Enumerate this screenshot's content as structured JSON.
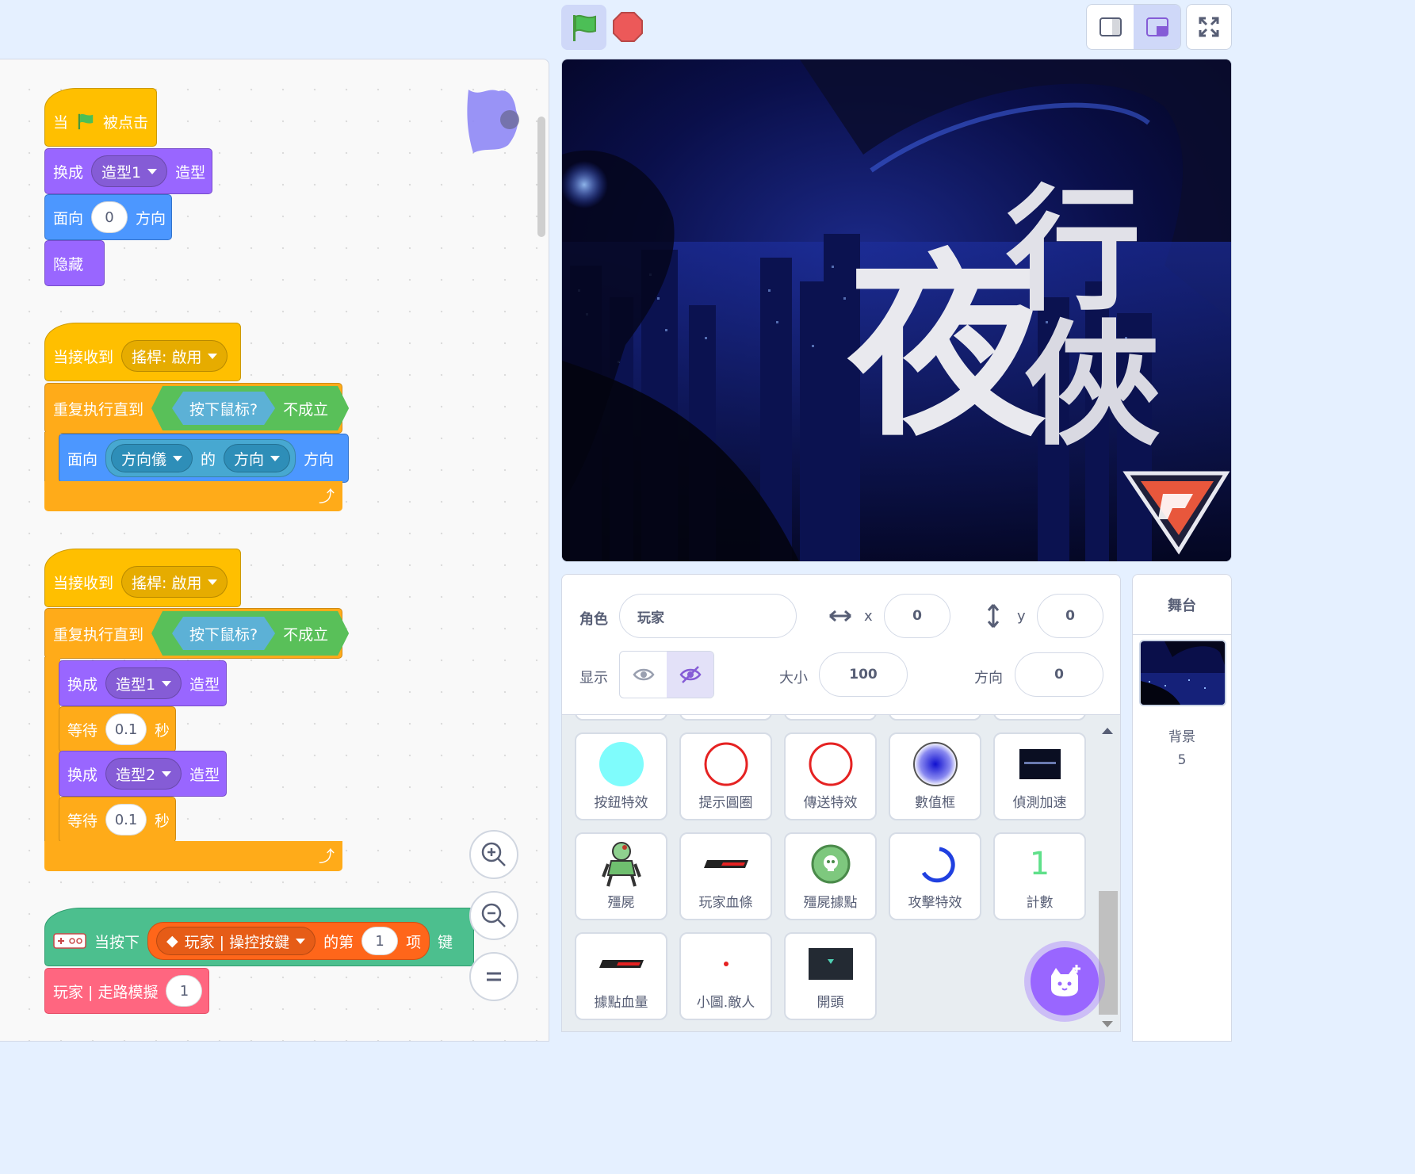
{
  "blocks": {
    "script1": {
      "hat_when": "当",
      "hat_clicked": "被点击",
      "switch_label": "换成",
      "costume1": "造型1",
      "costume_suffix": "造型",
      "point_label": "面向",
      "point_value": "0",
      "direction_suffix": "方向",
      "hide_label": "隐藏"
    },
    "script2": {
      "when_receive": "当接收到",
      "message": "搖桿: 啟用",
      "repeat_until": "重复执行直到",
      "mouse_down": "按下鼠标?",
      "not_true": "不成立",
      "point_label": "面向",
      "joystick": "方向儀",
      "of_label": "的",
      "direction_attr": "方向",
      "direction_suffix": "方向"
    },
    "script3": {
      "when_receive": "当接收到",
      "message": "搖桿: 啟用",
      "repeat_until": "重复执行直到",
      "mouse_down": "按下鼠标?",
      "not_true": "不成立",
      "switch_label": "换成",
      "costume1": "造型1",
      "costume_suffix": "造型",
      "wait_label": "等待",
      "wait_value": "0.1",
      "seconds_suffix": "秒",
      "costume2": "造型2"
    },
    "script4": {
      "when_pressed": "当按下",
      "key_reporter": "玩家 | 操控按鍵",
      "index_prefix": "的第",
      "index_value": "1",
      "item_label": "项",
      "key_suffix": "键",
      "custom_block": "玩家 | 走路模擬",
      "custom_arg": "1"
    }
  },
  "sprite_info": {
    "sprite_label": "角色",
    "sprite_name": "玩家",
    "x_label": "x",
    "x_value": "0",
    "y_label": "y",
    "y_value": "0",
    "show_label": "显示",
    "size_label": "大小",
    "size_value": "100",
    "direction_label": "方向",
    "direction_value": "0"
  },
  "sprites": [
    {
      "name": "按鈕特效",
      "thumb": "cyan-circle"
    },
    {
      "name": "提示圓圈",
      "thumb": "red-ring"
    },
    {
      "name": "傳送特效",
      "thumb": "red-ring"
    },
    {
      "name": "數值框",
      "thumb": "blue-orb"
    },
    {
      "name": "偵測加速",
      "thumb": "dark-rect"
    },
    {
      "name": "殭屍",
      "thumb": "zombie"
    },
    {
      "name": "玩家血條",
      "thumb": "health-bar"
    },
    {
      "name": "殭屍據點",
      "thumb": "green-skull"
    },
    {
      "name": "攻擊特效",
      "thumb": "blue-arc"
    },
    {
      "name": "計數",
      "thumb": "number-one"
    },
    {
      "name": "據點血量",
      "thumb": "health-bar"
    },
    {
      "name": "小圖.敵人",
      "thumb": "red-dot"
    },
    {
      "name": "開頭",
      "thumb": "dark-screen"
    }
  ],
  "stage_panel": {
    "title": "舞台",
    "backdrops_label": "背景",
    "backdrops_count": "5"
  },
  "counter_glyph": "1",
  "colors": {
    "events": "#ffbf00",
    "control": "#ffab19",
    "looks": "#9966ff",
    "motion": "#4c97ff",
    "sensing": "#5cb1d6",
    "operators": "#59c059",
    "extension": "#4cbf8e",
    "my_blocks": "#ff6680",
    "accent": "#855cd6"
  }
}
